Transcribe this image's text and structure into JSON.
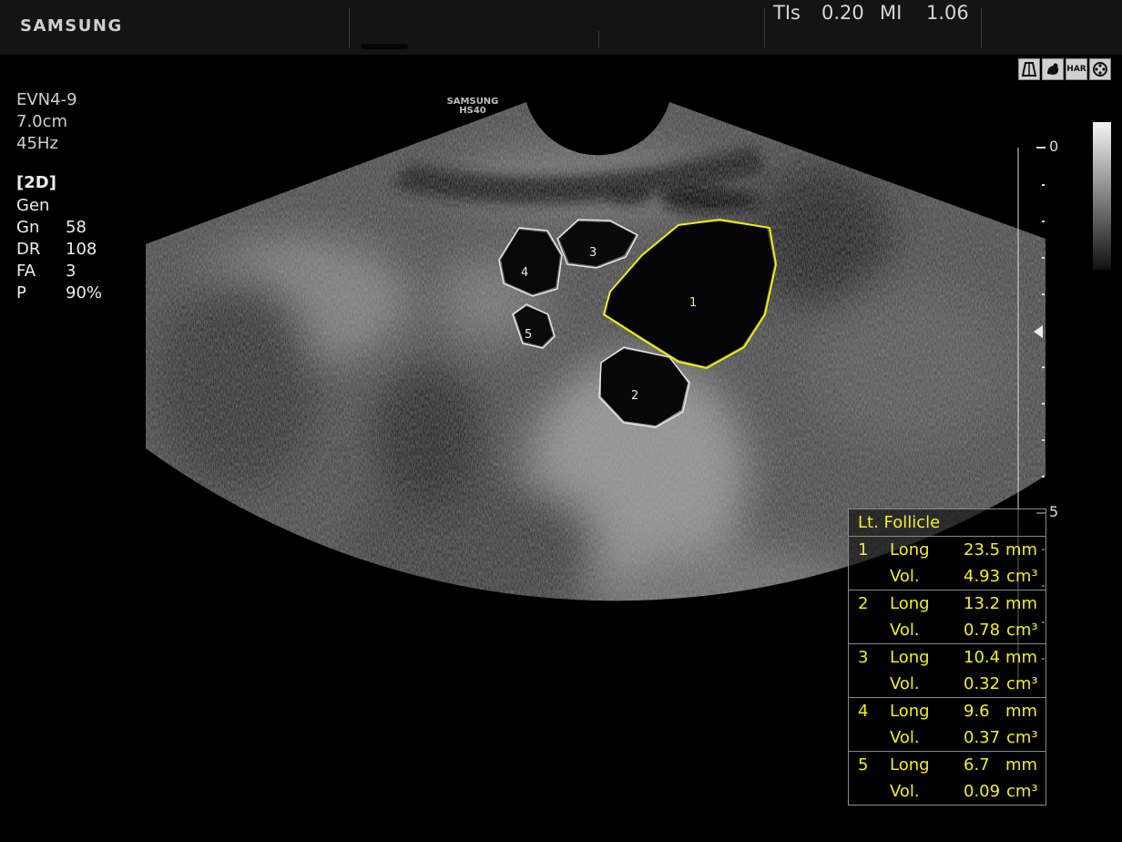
{
  "topbar": {
    "brand": "SAMSUNG",
    "tis_label": "TIs",
    "tis_value": "0.20",
    "mi_label": "MI",
    "mi_value": "1.06"
  },
  "icons": [
    "probe-icon",
    "fetus-icon",
    "har-icon",
    "reel-icon"
  ],
  "icon_text": {
    "har": "HAR"
  },
  "params": {
    "probe": "EVN4-9",
    "depth": "7.0cm",
    "frame_rate": "45Hz",
    "mode": "[2D]",
    "preset": "Gen",
    "items": [
      {
        "key": "Gn",
        "value": "58"
      },
      {
        "key": "DR",
        "value": "108"
      },
      {
        "key": "FA",
        "value": "3"
      },
      {
        "key": "P",
        "value": "90%"
      }
    ]
  },
  "model": {
    "line1": "SAMSUNG",
    "line2": "HS40"
  },
  "follicle_labels": [
    "1",
    "2",
    "3",
    "4",
    "5"
  ],
  "depth_scale": {
    "top": "0",
    "mid": "5"
  },
  "table": {
    "title": "Lt. Follicle",
    "rows": [
      {
        "index": "1",
        "long_label": "Long",
        "long_value": "23.5",
        "long_unit": "mm",
        "vol_label": "Vol.",
        "vol_value": "4.93",
        "vol_unit": "cm³"
      },
      {
        "index": "2",
        "long_label": "Long",
        "long_value": "13.2",
        "long_unit": "mm",
        "vol_label": "Vol.",
        "vol_value": "0.78",
        "vol_unit": "cm³"
      },
      {
        "index": "3",
        "long_label": "Long",
        "long_value": "10.4",
        "long_unit": "mm",
        "vol_label": "Vol.",
        "vol_value": "0.32",
        "vol_unit": "cm³"
      },
      {
        "index": "4",
        "long_label": "Long",
        "long_value": "9.6",
        "long_unit": "mm",
        "vol_label": "Vol.",
        "vol_value": "0.37",
        "vol_unit": "cm³"
      },
      {
        "index": "5",
        "long_label": "Long",
        "long_value": "6.7",
        "long_unit": "mm",
        "vol_label": "Vol.",
        "vol_value": "0.09",
        "vol_unit": "cm³"
      }
    ]
  },
  "colors": {
    "measurement": "#f2ef1e",
    "selected_trace": "#f0f000",
    "trace": "#e6e6e6"
  }
}
